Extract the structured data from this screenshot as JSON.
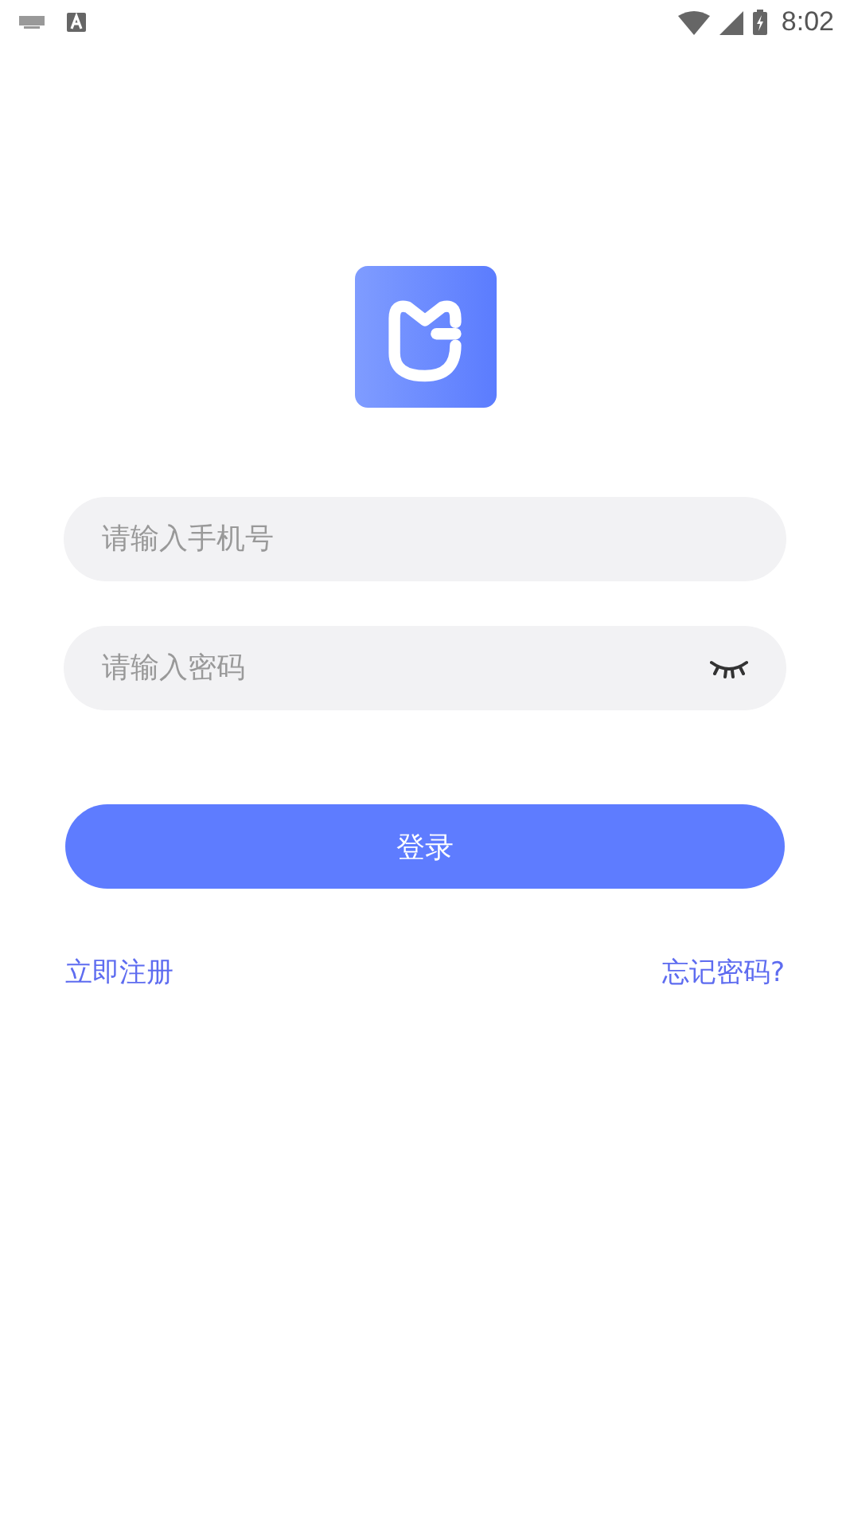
{
  "status_bar": {
    "time": "8:02"
  },
  "phone_field": {
    "placeholder": "请输入手机号"
  },
  "password_field": {
    "placeholder": "请输入密码",
    "visible": false
  },
  "login_button": "登录",
  "links": {
    "register": "立即注册",
    "forgot": "忘记密码?"
  }
}
